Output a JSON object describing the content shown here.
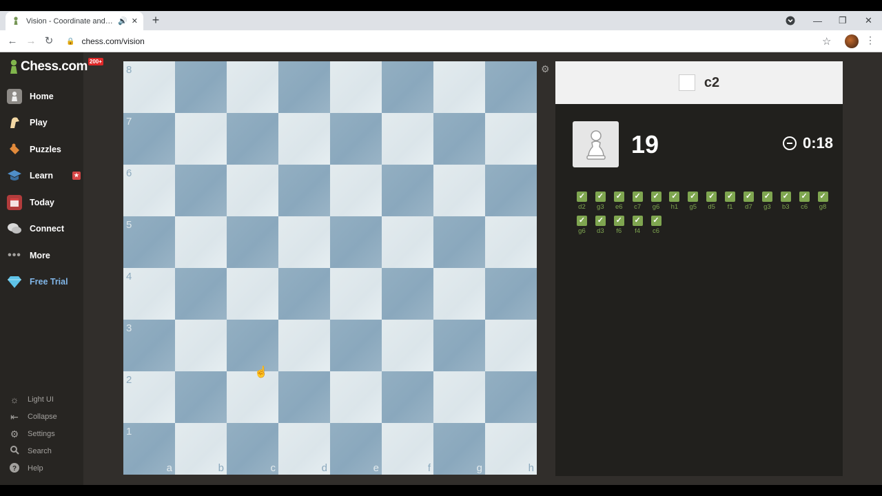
{
  "browser": {
    "tab_title": "Vision - Coordinate and Move Training",
    "url": "chess.com/vision"
  },
  "sidebar": {
    "logo_text": "Chess.com",
    "logo_badge": "200+",
    "nav": [
      {
        "label": "Home",
        "icon": "home-icon"
      },
      {
        "label": "Play",
        "icon": "play-icon"
      },
      {
        "label": "Puzzles",
        "icon": "puzzles-icon"
      },
      {
        "label": "Learn",
        "icon": "learn-icon"
      },
      {
        "label": "Today",
        "icon": "today-icon"
      },
      {
        "label": "Connect",
        "icon": "connect-icon"
      },
      {
        "label": "More",
        "icon": "more-icon"
      },
      {
        "label": "Free Trial",
        "icon": "diamond-icon"
      }
    ],
    "bottom": [
      {
        "label": "Light UI",
        "icon": "sun-icon"
      },
      {
        "label": "Collapse",
        "icon": "collapse-icon"
      },
      {
        "label": "Settings",
        "icon": "gear-icon"
      },
      {
        "label": "Search",
        "icon": "search-icon"
      },
      {
        "label": "Help",
        "icon": "help-icon"
      }
    ]
  },
  "board": {
    "ranks": [
      "8",
      "7",
      "6",
      "5",
      "4",
      "3",
      "2",
      "1"
    ],
    "files": [
      "a",
      "b",
      "c",
      "d",
      "e",
      "f",
      "g",
      "h"
    ],
    "light_color": "#e3ebee",
    "dark_color": "#8aa8bd"
  },
  "panel": {
    "target_square": "c2",
    "score": "19",
    "timer": "0:18",
    "results": [
      "d2",
      "g3",
      "e6",
      "c7",
      "g6",
      "h1",
      "g5",
      "d5",
      "f1",
      "d7",
      "g3",
      "b3",
      "c6",
      "g8",
      "g6",
      "d3",
      "f6",
      "f4",
      "c6"
    ],
    "correct_color": "#7fa650"
  }
}
